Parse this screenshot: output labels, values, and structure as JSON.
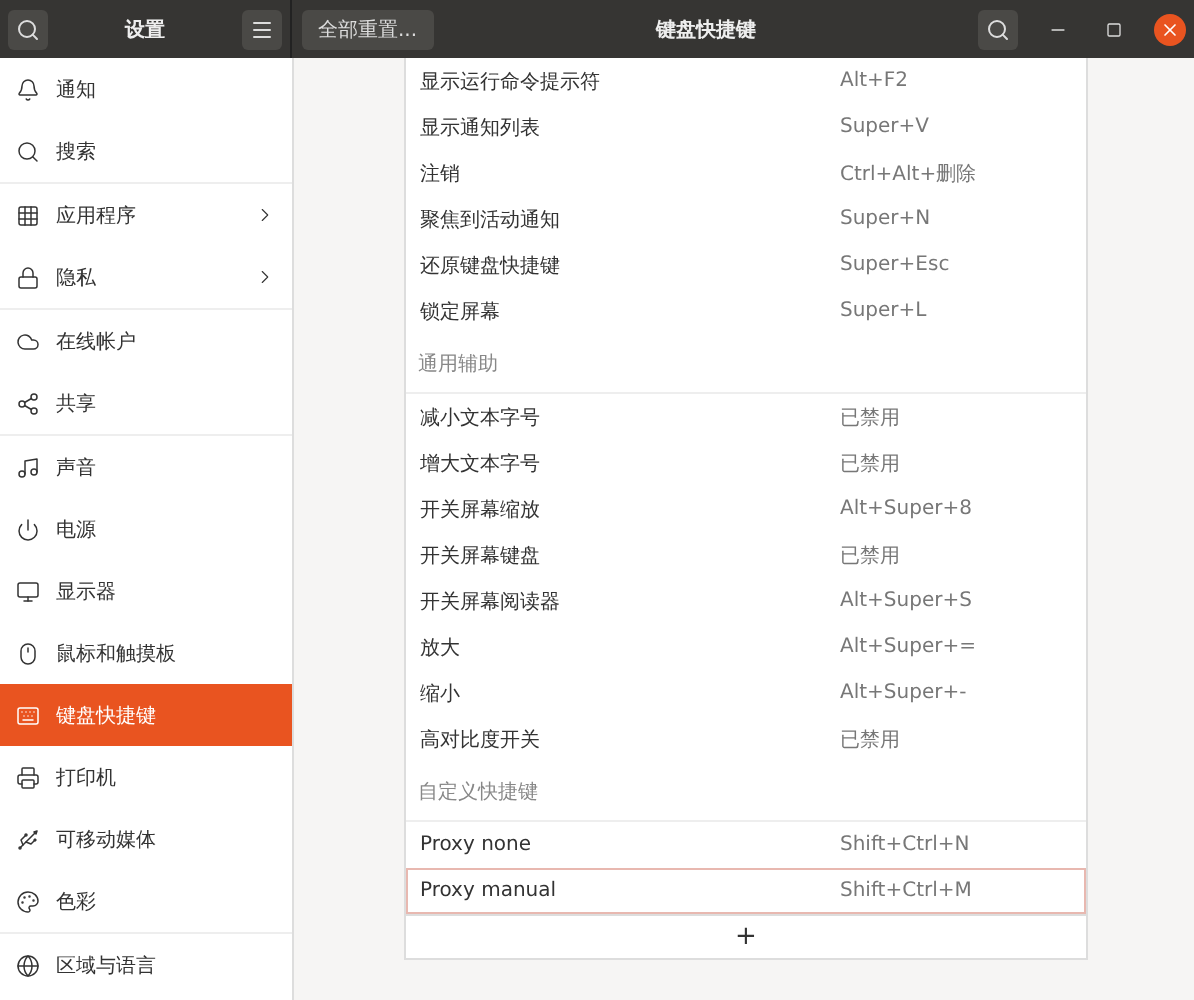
{
  "header": {
    "sidebar_title": "设置",
    "reset_button": "全部重置...",
    "page_title": "键盘快捷键"
  },
  "sidebar": {
    "groups": [
      [
        {
          "label": "通知",
          "selected": false,
          "submenu": false
        },
        {
          "label": "搜索",
          "selected": false,
          "submenu": false
        }
      ],
      [
        {
          "label": "应用程序",
          "selected": false,
          "submenu": true
        },
        {
          "label": "隐私",
          "selected": false,
          "submenu": true
        }
      ],
      [
        {
          "label": "在线帐户",
          "selected": false,
          "submenu": false
        },
        {
          "label": "共享",
          "selected": false,
          "submenu": false
        }
      ],
      [
        {
          "label": "声音",
          "selected": false,
          "submenu": false
        },
        {
          "label": "电源",
          "selected": false,
          "submenu": false
        },
        {
          "label": "显示器",
          "selected": false,
          "submenu": false
        },
        {
          "label": "鼠标和触摸板",
          "selected": false,
          "submenu": false
        },
        {
          "label": "键盘快捷键",
          "selected": true,
          "submenu": false
        },
        {
          "label": "打印机",
          "selected": false,
          "submenu": false
        },
        {
          "label": "可移动媒体",
          "selected": false,
          "submenu": false
        },
        {
          "label": "色彩",
          "selected": false,
          "submenu": false
        }
      ],
      [
        {
          "label": "区域与语言",
          "selected": false,
          "submenu": false
        }
      ]
    ]
  },
  "sections": [
    {
      "rows": [
        {
          "name": "显示运行命令提示符",
          "shortcut": "Alt+F2",
          "selected": false
        },
        {
          "name": "显示通知列表",
          "shortcut": "Super+V",
          "selected": false
        },
        {
          "name": "注销",
          "shortcut": "Ctrl+Alt+删除",
          "selected": false
        },
        {
          "name": "聚焦到活动通知",
          "shortcut": "Super+N",
          "selected": false
        },
        {
          "name": "还原键盘快捷键",
          "shortcut": "Super+Esc",
          "selected": false
        },
        {
          "name": "锁定屏幕",
          "shortcut": "Super+L",
          "selected": false
        }
      ]
    },
    {
      "title": "通用辅助",
      "rows": [
        {
          "name": "减小文本字号",
          "shortcut": "已禁用",
          "selected": false
        },
        {
          "name": "增大文本字号",
          "shortcut": "已禁用",
          "selected": false
        },
        {
          "name": "开关屏幕缩放",
          "shortcut": "Alt+Super+8",
          "selected": false
        },
        {
          "name": "开关屏幕键盘",
          "shortcut": "已禁用",
          "selected": false
        },
        {
          "name": "开关屏幕阅读器",
          "shortcut": "Alt+Super+S",
          "selected": false
        },
        {
          "name": "放大",
          "shortcut": "Alt+Super+=",
          "selected": false
        },
        {
          "name": "缩小",
          "shortcut": "Alt+Super+-",
          "selected": false
        },
        {
          "name": "高对比度开关",
          "shortcut": "已禁用",
          "selected": false
        }
      ]
    },
    {
      "title": "自定义快捷键",
      "rows": [
        {
          "name": "Proxy none",
          "shortcut": "Shift+Ctrl+N",
          "selected": false
        },
        {
          "name": "Proxy manual",
          "shortcut": "Shift+Ctrl+M",
          "selected": true
        }
      ]
    }
  ],
  "add_button": "+"
}
